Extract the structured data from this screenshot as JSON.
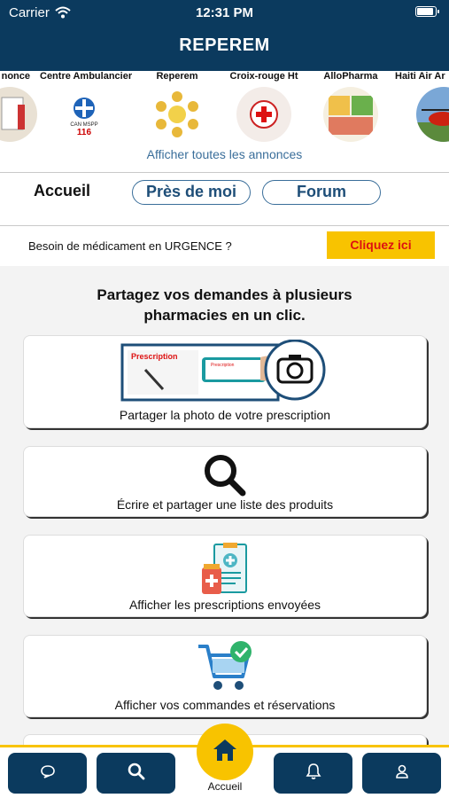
{
  "status": {
    "carrier": "Carrier",
    "time": "12:31 PM"
  },
  "app": {
    "title": "REPEREM"
  },
  "carousel": {
    "items": [
      {
        "label": "nonce"
      },
      {
        "label": "Centre Ambulancier",
        "thumb_text_1": "CAN MSPP",
        "thumb_text_2": "116"
      },
      {
        "label": "Reperem"
      },
      {
        "label": "Croix-rouge Ht"
      },
      {
        "label": "AlloPharma"
      },
      {
        "label": "Haiti Air Ar"
      }
    ],
    "show_all": "Afficher toutes les annonces"
  },
  "tabs": {
    "home": "Accueil",
    "near_me": "Près de moi",
    "forum": "Forum"
  },
  "urgent": {
    "text": "Besoin de médicament en URGENCE ?",
    "button": "Cliquez ici"
  },
  "intro": {
    "line1": "Partagez vos demandes à plusieurs",
    "line2": "pharmacies en un clic."
  },
  "cards": [
    {
      "label": "Partager la photo de votre prescription",
      "image_text_1": "Prescription",
      "image_text_2": "Prescription"
    },
    {
      "label": "Écrire et partager une liste des produits"
    },
    {
      "label": "Afficher les prescriptions envoyées"
    },
    {
      "label": "Afficher vos commandes et réservations"
    }
  ],
  "bottom_nav": {
    "home_label": "Accueil"
  },
  "colors": {
    "brand": "#0b3a5e",
    "accent": "#f8c300",
    "urgent_text": "#dd1111",
    "link": "#3a6e9a"
  }
}
